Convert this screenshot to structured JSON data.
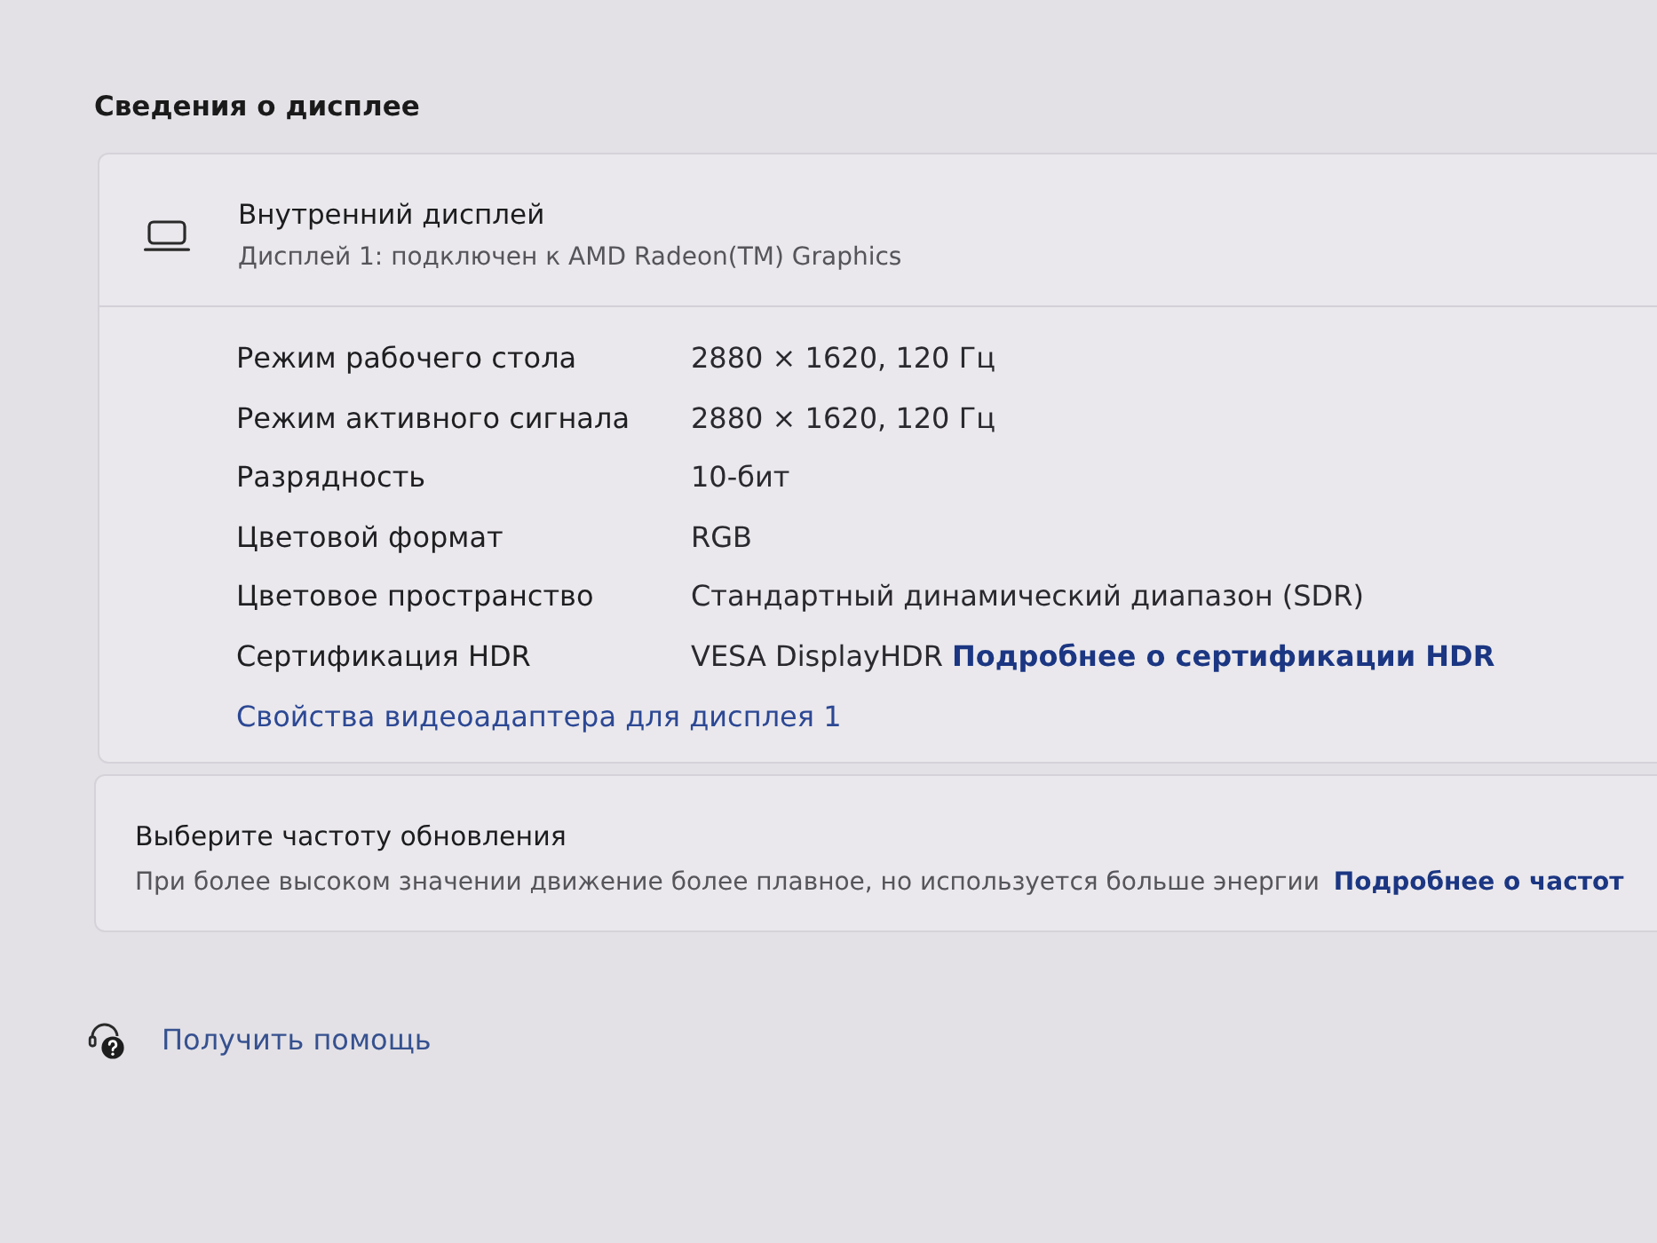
{
  "section_title": "Сведения о дисплее",
  "display_card": {
    "title": "Внутренний дисплей",
    "subtitle": "Дисплей 1: подключен к AMD Radeon(TM) Graphics",
    "properties": [
      {
        "label": "Режим рабочего стола",
        "value": "2880 × 1620, 120 Гц"
      },
      {
        "label": "Режим активного сигнала",
        "value": "2880 × 1620, 120 Гц"
      },
      {
        "label": "Разрядность",
        "value": "10-бит"
      },
      {
        "label": "Цветовой формат",
        "value": "RGB"
      },
      {
        "label": "Цветовое пространство",
        "value": "Стандартный динамический диапазон (SDR)"
      },
      {
        "label": "Сертификация HDR",
        "value": "VESA DisplayHDR",
        "link": "Подробнее о сертификации HDR"
      }
    ],
    "adapter_link": "Свойства видеоадаптера для дисплея 1"
  },
  "refresh_card": {
    "title": "Выберите частоту обновления",
    "description": "При более высоком значении движение более плавное, но используется больше энергии",
    "link": "Подробнее о частот"
  },
  "help_link": "Получить помощь"
}
